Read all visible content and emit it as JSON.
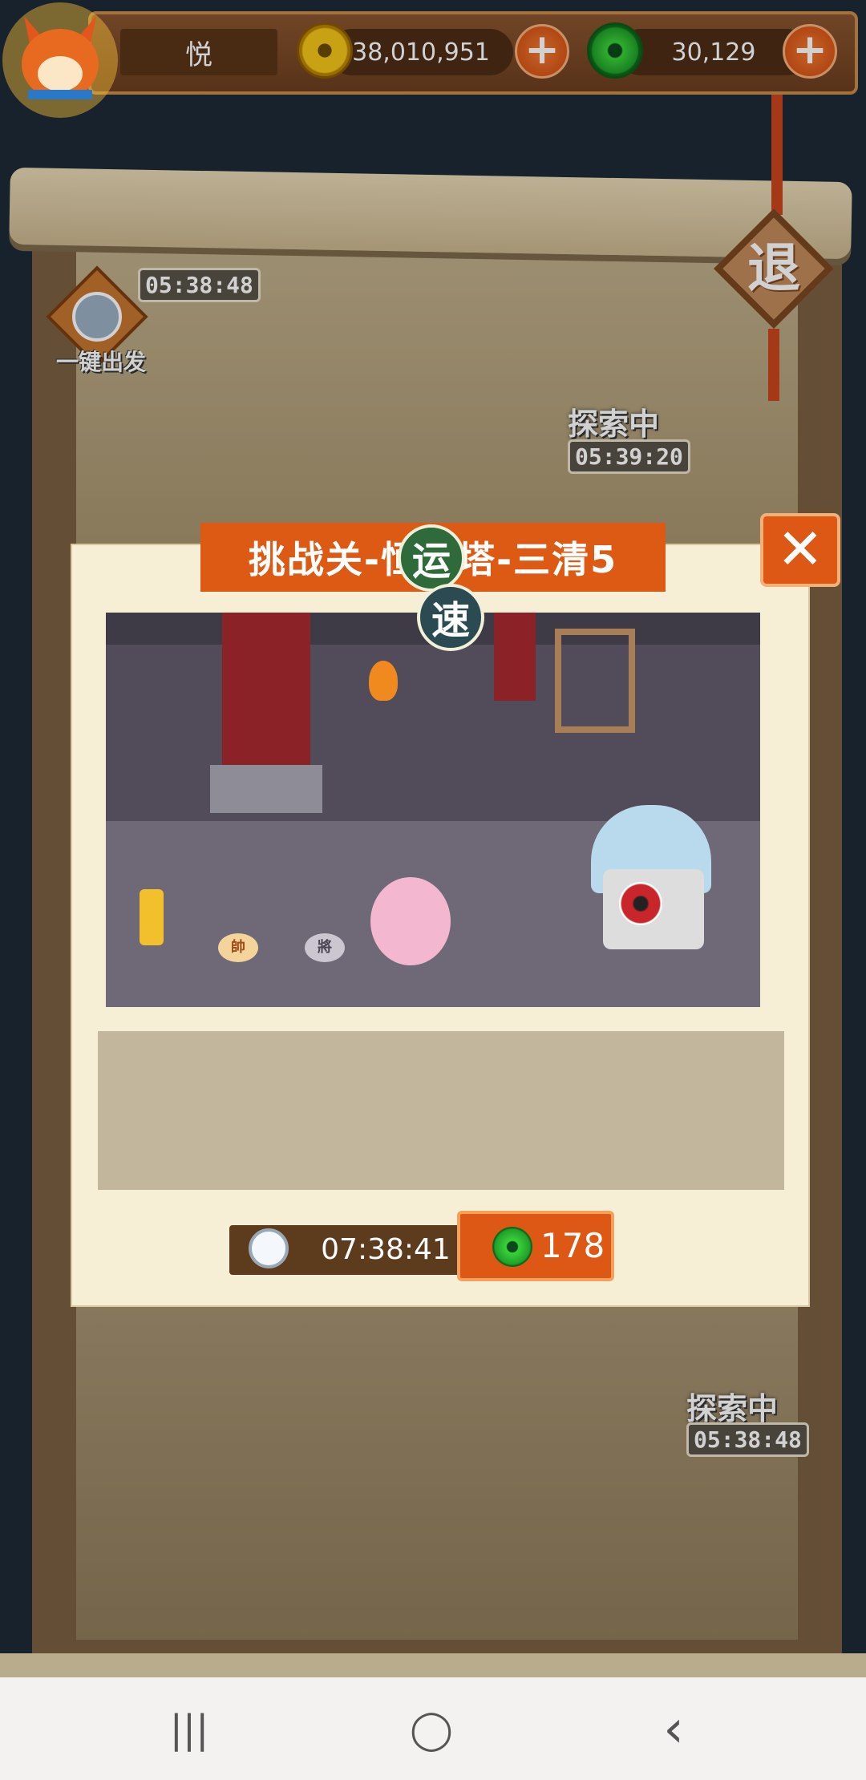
{
  "hud": {
    "player_name": "悦",
    "gold_amount": "38,010,951",
    "jade_amount": "30,129",
    "plus_symbol": "+"
  },
  "map": {
    "timers": {
      "top_left": "05:38:48",
      "middle_right": "05:39:20",
      "lower_right": "05:38:48"
    },
    "exploring_label": "探索中",
    "quick_depart_label": "一键出发",
    "exit_label": "退"
  },
  "modal": {
    "title": "挑战关-恒运塔-三清5",
    "badge_luck": "运",
    "badge_speed": "速",
    "close_symbol": "✕",
    "scene": {
      "piece_shuai": "帥",
      "piece_jiang": "將"
    },
    "timer": "07:38:41",
    "cost": "178"
  },
  "colors": {
    "accent_orange": "#dc5a13",
    "modal_bg": "#f7eed6",
    "hud_brown": "#6b3e1f"
  },
  "nav": {
    "recent_symbol": "|||",
    "home_symbol": "◯",
    "back_symbol": "‹"
  }
}
